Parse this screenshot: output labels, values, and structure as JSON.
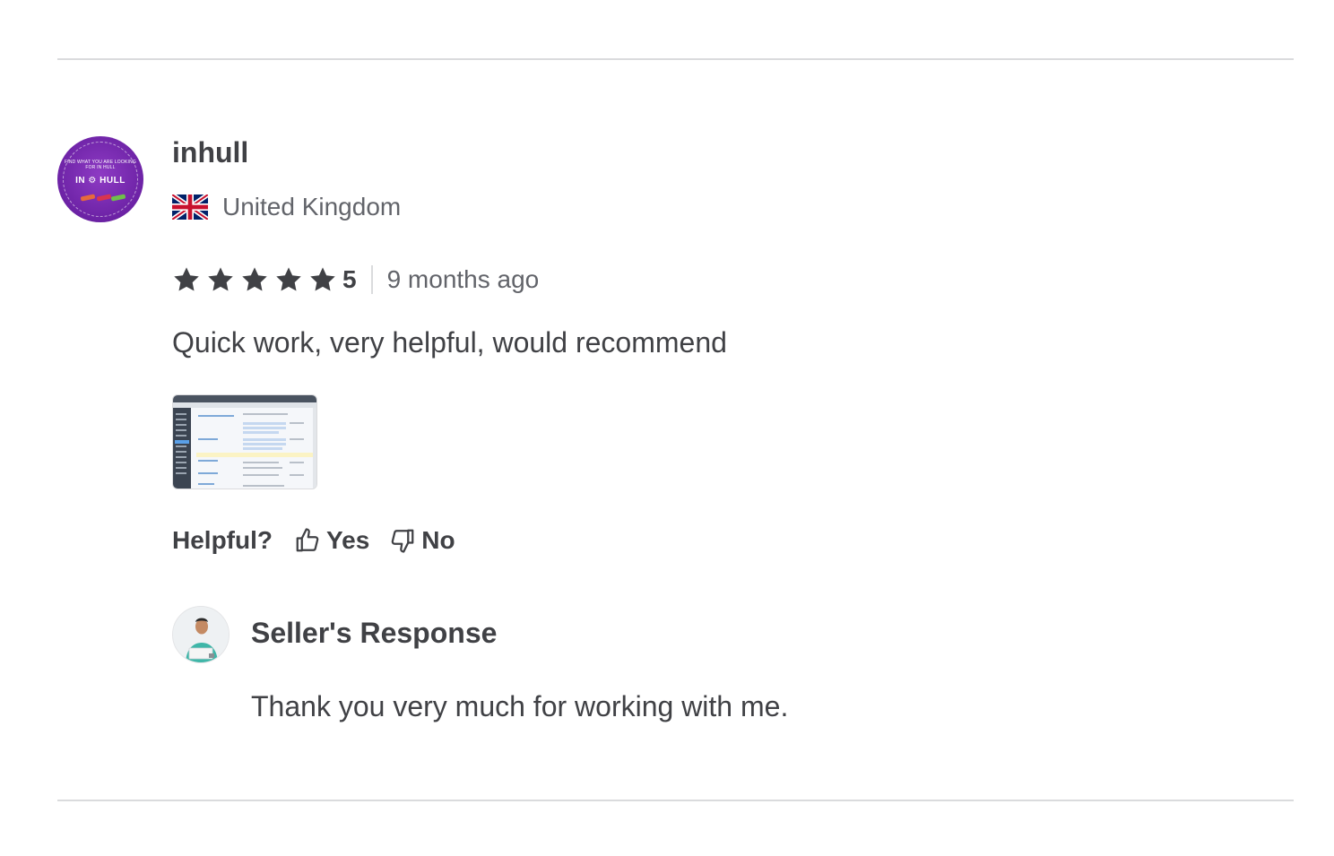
{
  "review": {
    "username": "inhull",
    "avatar_lettering": "FIND WHAT YOU ARE LOOKING FOR IN HULL · IN HULL",
    "country": "United Kingdom",
    "flag_icon": "uk-flag-icon",
    "rating": {
      "stars": 5,
      "max": 5,
      "value_label": "5"
    },
    "date": "9 months ago",
    "comment": "Quick work, very helpful, would recommend",
    "attachment_icon": "review-screenshot-thumbnail",
    "helpful": {
      "label": "Helpful?",
      "yes_label": "Yes",
      "no_label": "No"
    }
  },
  "seller_response": {
    "title": "Seller's Response",
    "text": "Thank you very much for working with me."
  },
  "colors": {
    "text_primary": "#404145",
    "text_secondary": "#62646a",
    "divider": "#dadbdd",
    "avatar_purple": "#6c22a5"
  }
}
